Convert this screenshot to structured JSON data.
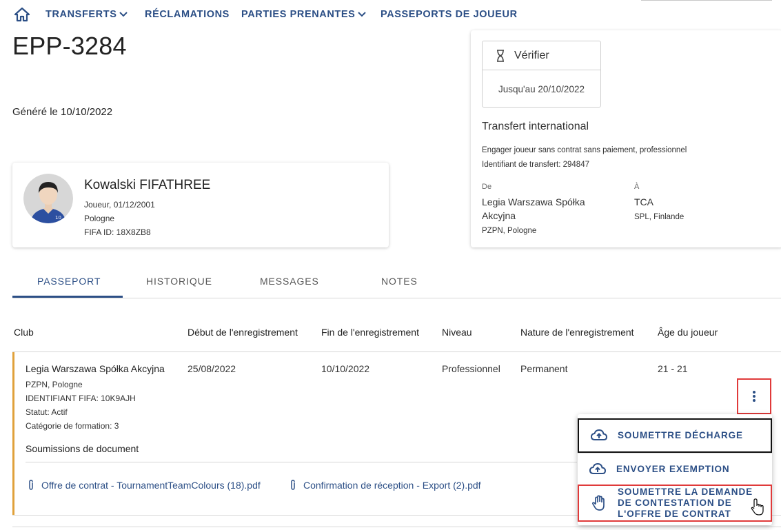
{
  "nav": {
    "items": [
      {
        "label": "TRANSFERTS",
        "has_dropdown": true
      },
      {
        "label": "RÉCLAMATIONS",
        "has_dropdown": false
      },
      {
        "label": "PARTIES PRENANTES",
        "has_dropdown": true
      },
      {
        "label": "PASSEPORTS DE JOUEUR",
        "has_dropdown": false
      }
    ],
    "home_icon": "home-icon"
  },
  "page": {
    "title": "EPP-3284",
    "generated": "Généré le 10/10/2022"
  },
  "player": {
    "name": "Kowalski FIFATHREE",
    "role_dob": "Joueur, 01/12/2001",
    "country": "Pologne",
    "fifa_id": "FIFA ID: 18X8ZB8",
    "jersey_number": "10"
  },
  "transfer": {
    "status_label": "Vérifier",
    "status_icon": "hourglass-icon",
    "deadline": "Jusqu'au 20/10/2022",
    "title": "Transfert international",
    "description": "Engager joueur sans contrat sans paiement, professionnel",
    "transfer_id": "Identifiant de transfert: 294847",
    "from_label": "De",
    "from_club": "Legia Warszawa Spółka Akcyjna",
    "from_assoc": "PZPN, Pologne",
    "to_label": "À",
    "to_club": "TCA",
    "to_assoc": "SPL, Finlande"
  },
  "tabs": [
    {
      "label": "PASSEPORT",
      "active": true
    },
    {
      "label": "HISTORIQUE",
      "active": false
    },
    {
      "label": "MESSAGES",
      "active": false
    },
    {
      "label": "NOTES",
      "active": false
    }
  ],
  "table": {
    "headers": [
      "Club",
      "Début de l'enregistrement",
      "Fin de l'enregistrement",
      "Niveau",
      "Nature de l'enregistrement",
      "Âge du joueur"
    ],
    "row": {
      "club": "Legia Warszawa Spółka Akcyjna",
      "assoc": "PZPN, Pologne",
      "fifa_id": "IDENTIFIANT FIFA: 10K9AJH",
      "status": "Statut: Actif",
      "training_category": "Catégorie de formation: 3",
      "start": "25/08/2022",
      "end": "10/10/2022",
      "level": "Professionnel",
      "nature": "Permanent",
      "age": "21 - 21"
    },
    "documents_heading": "Soumissions de document",
    "documents": [
      "Offre de contrat - TournamentTeamColours (18).pdf",
      "Confirmation de réception - Export (2).pdf"
    ]
  },
  "menu": {
    "items": [
      {
        "label": "SOUMETTRE DÉCHARGE",
        "icon": "cloud-upload-icon"
      },
      {
        "label": "ENVOYER EXEMPTION",
        "icon": "cloud-upload-icon"
      },
      {
        "label": "SOUMETTRE LA DEMANDE DE CONTESTATION DE L'OFFRE DE CONTRAT",
        "icon": "hand-stop-icon"
      }
    ]
  },
  "colors": {
    "primary": "#2c4f86",
    "accent_row": "#e0a13a",
    "highlight": "#e03a3a"
  }
}
